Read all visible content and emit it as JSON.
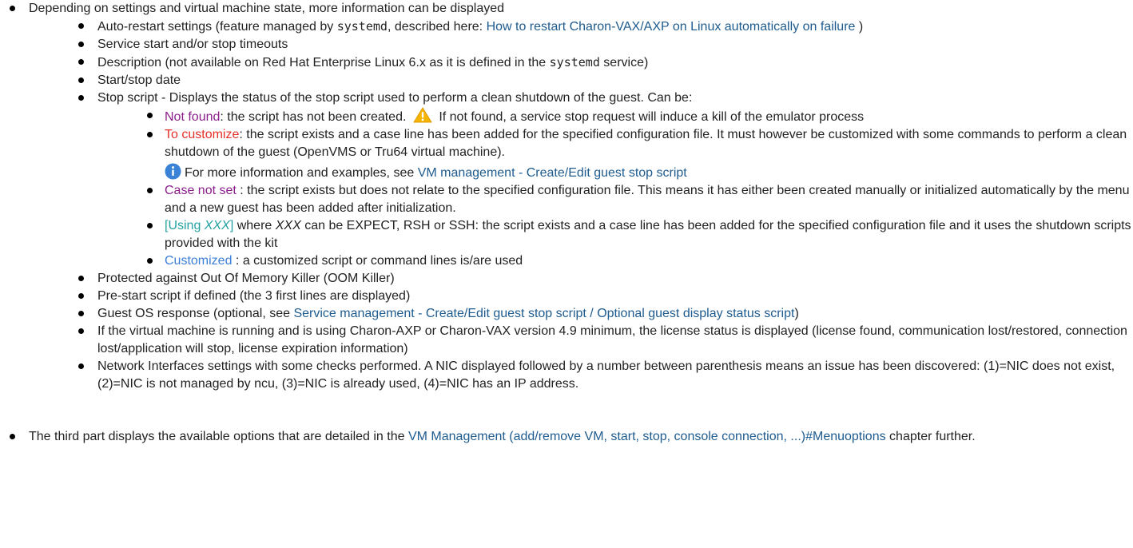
{
  "intro_item": "Depending on settings and virtual machine state, more information can be displayed",
  "auto_restart": {
    "text_before": "Auto-restart settings (feature managed by ",
    "code": "systemd",
    "text_middle": ", described here: ",
    "link": "How to restart Charon-VAX/AXP on Linux automatically on failure",
    "text_after": " )"
  },
  "timeouts": "Service start and/or stop timeouts",
  "description": {
    "text_before": "Description (not available on Red Hat Enterprise Linux 6.x as it is defined in the ",
    "code": "systemd",
    "text_after": " service)"
  },
  "start_stop_date": "Start/stop date",
  "stop_script": {
    "label": "Stop script - Displays the status of the stop script used to perform a clean shutdown of the guest. Can be:",
    "not_found": {
      "status": "Not found",
      "text": ": the script has not been created. ",
      "warning_text": " If not found, a service stop request will induce a kill of the emulator process"
    },
    "to_customize": {
      "status": "To customize",
      "text": ": the script exists and a case line has been added for the specified configuration file. It must however be customized with some commands to perform a clean shutdown of the guest (OpenVMS or Tru64 virtual machine).",
      "info_text": "For more information and examples, see ",
      "info_link": "VM management - Create/Edit guest stop script"
    },
    "case_not_set": {
      "status": "Case not set",
      "text": " : the script exists but does not relate to the specified configuration file. This means it has either been created manually or initialized automatically by the menu and a new guest has been added after initialization."
    },
    "using": {
      "status_open": "[Using ",
      "status_var": "XXX",
      "status_close": "]",
      "text_where": " where ",
      "var": "XXX",
      "text": " can be EXPECT, RSH or SSH: the script exists and a case line has been added for the specified configuration file and it uses the shutdown scripts provided with the kit"
    },
    "customized": {
      "status": "Customized",
      "text": " : a customized script or command lines is/are used"
    }
  },
  "oom": "Protected against Out Of Memory Killer (OOM Killer)",
  "prestart": "Pre-start script if defined (the 3 first lines are displayed)",
  "guest_os": {
    "text_before": "Guest OS response (optional, see ",
    "link": "Service management - Create/Edit guest stop script / Optional guest display status script",
    "text_after": ")"
  },
  "license": "If the virtual machine is running and is using Charon-AXP or Charon-VAX version 4.9 minimum, the license status is displayed (license found, communication lost/restored, connection lost/application will stop, license expiration information)",
  "nic": "Network Interfaces settings with some checks performed. A NIC displayed followed by a number between parenthesis means an issue has been discovered: (1)=NIC does not exist, (2)=NIC is not managed by ncu, (3)=NIC is already used, (4)=NIC has an IP address.",
  "third_part": {
    "text_before": "The third part displays the available options that are detailed in the ",
    "link": "VM Management (add/remove VM, start, stop, console connection, ...)#Menuoptions",
    "text_after": " chapter further."
  },
  "colors": {
    "link": "#1e5b8f",
    "not_found": "#8b1e8b",
    "to_customize": "#e5302a",
    "case_not_set": "#8b1e8b",
    "using": "#25a1a1",
    "customized": "#3b7fd9"
  },
  "icons": {
    "warning": "warning-icon",
    "info": "info-icon"
  }
}
